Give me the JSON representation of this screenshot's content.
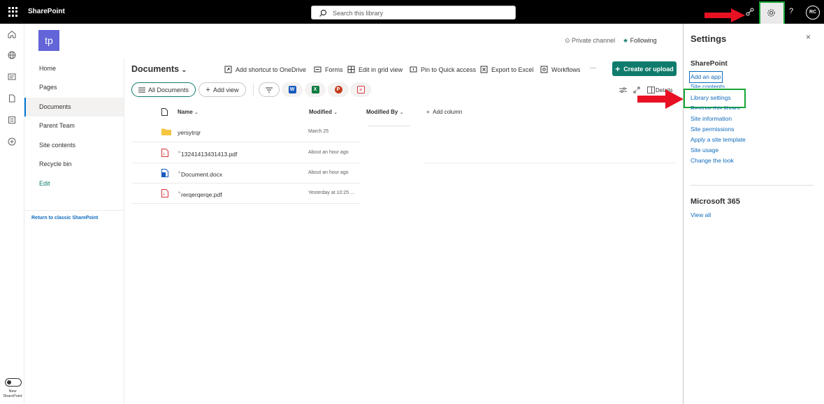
{
  "app": {
    "brand": "SharePoint",
    "search_placeholder": "Search this library",
    "help": "?",
    "avatar_initials": "RC"
  },
  "site": {
    "logo_initials": "tp",
    "private_channel": "Private channel",
    "following": "Following"
  },
  "nav": {
    "items": [
      {
        "label": "Home"
      },
      {
        "label": "Pages"
      },
      {
        "label": "Documents",
        "active": true
      },
      {
        "label": "Parent Team"
      },
      {
        "label": "Site contents"
      },
      {
        "label": "Recycle bin"
      },
      {
        "label": "Edit"
      }
    ],
    "return_classic": "Return to classic SharePoint",
    "new_sharepoint": "New SharePoint"
  },
  "library": {
    "title": "Documents",
    "commands": [
      "Add shortcut to OneDrive",
      "Forms",
      "Edit in grid view",
      "Pin to Quick access",
      "Export to Excel",
      "Workflows",
      "···"
    ],
    "create_button": "Create or upload",
    "views": {
      "all": "All Documents",
      "add": "Add view"
    },
    "details_label": "Details",
    "columns": {
      "name": "Name",
      "modified": "Modified",
      "modified_by": "Modified By",
      "add_column": "Add column"
    },
    "rows": [
      {
        "type": "folder",
        "name": "yersytrqr",
        "modified": "March 25"
      },
      {
        "type": "pdf",
        "name": "13241413431413.pdf",
        "modified": "About an hour ago"
      },
      {
        "type": "docx",
        "name": "Document.docx",
        "modified": "About an hour ago"
      },
      {
        "type": "pdf",
        "name": "rerqerqerqe.pdf",
        "modified": "Yesterday at 10:25 ..."
      }
    ]
  },
  "settings": {
    "title": "Settings",
    "close": "×",
    "sharepoint_heading": "SharePoint",
    "links": [
      "Add an app",
      "Site contents",
      "Library settings",
      "Restore this library",
      "Site information",
      "Site permissions",
      "Apply a site template",
      "Site usage",
      "Change the look"
    ],
    "m365_heading": "Microsoft 365",
    "view_all": "View all"
  },
  "colors": {
    "accent": "#0f7b6c",
    "link": "#0f6cbd",
    "highlight_box": "#17a535",
    "annotation_arrow": "#e81123"
  }
}
